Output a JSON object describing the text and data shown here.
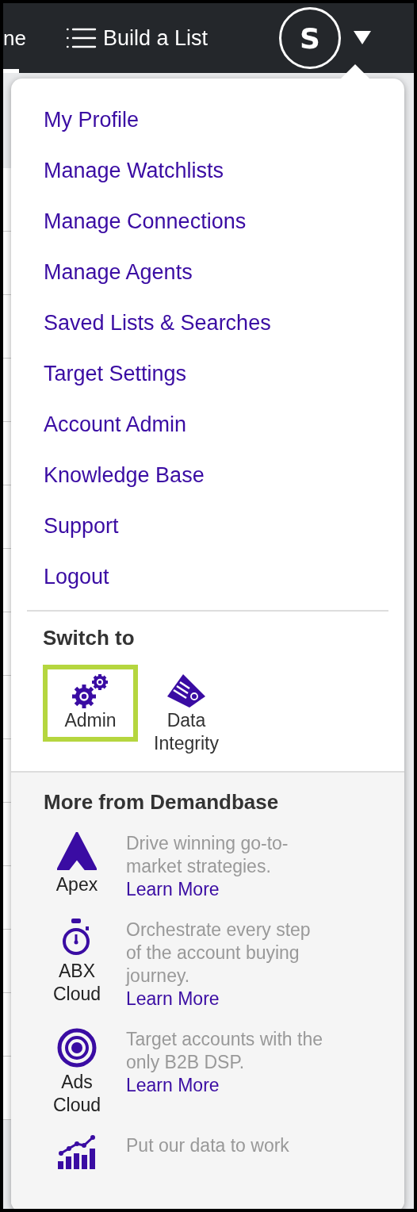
{
  "nav": {
    "partial_tab": "ne",
    "build_list": "Build a List",
    "avatar_initial": "S"
  },
  "menu": [
    "My Profile",
    "Manage Watchlists",
    "Manage Connections",
    "Manage Agents",
    "Saved Lists & Searches",
    "Target Settings",
    "Account Admin",
    "Knowledge Base",
    "Support",
    "Logout"
  ],
  "switch_to": {
    "title": "Switch to",
    "apps": [
      {
        "label": "Admin",
        "kind": "admin",
        "selected": true
      },
      {
        "label": "Data Integrity",
        "kind": "integrity",
        "selected": false
      }
    ]
  },
  "more": {
    "title": "More from Demandbase",
    "products": [
      {
        "name": "Apex",
        "kind": "apex",
        "description": "Drive winning go-to-market strategies.",
        "link": "Learn More"
      },
      {
        "name": "ABX Cloud",
        "kind": "abx",
        "description": "Orchestrate every step of the account buying journey.",
        "link": "Learn More"
      },
      {
        "name": "Ads Cloud",
        "kind": "ads",
        "description": "Target accounts with the only B2B DSP.",
        "link": "Learn More"
      },
      {
        "kind": "data",
        "description": "Put our data to work"
      }
    ]
  }
}
